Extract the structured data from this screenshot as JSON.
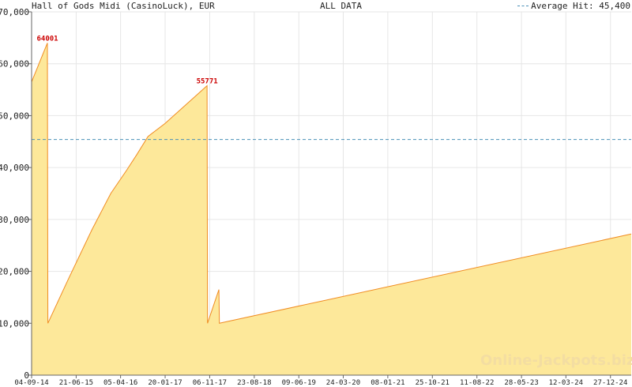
{
  "header": {
    "title": "Hall of Gods Midi (CasinoLuck), EUR",
    "subtitle": "ALL DATA",
    "legend_label": "Average Hit: 45,400"
  },
  "watermark": "Online-Jackpots.biz",
  "colors": {
    "fill": "#fde89a",
    "line": "#f08c22",
    "average": "#4a90b8",
    "peak_label": "#cc0000",
    "grid": "#e6e6e6"
  },
  "chart_data": {
    "type": "area",
    "title": "Hall of Gods Midi (CasinoLuck), EUR",
    "subtitle": "ALL DATA",
    "xlabel": "",
    "ylabel": "",
    "ylim": [
      0,
      70000
    ],
    "yticks": [
      0,
      10000,
      20000,
      30000,
      40000,
      50000,
      60000,
      70000
    ],
    "ytick_labels": [
      "0",
      "10,000",
      "20,000",
      "30,000",
      "40,000",
      "50,000",
      "60,000",
      "70,000"
    ],
    "xlim": [
      "2014-09-04",
      "2025-05-11"
    ],
    "xticks": [
      "2014-09-04",
      "2015-06-21",
      "2016-04-05",
      "2017-01-20",
      "2017-11-06",
      "2018-08-23",
      "2019-06-09",
      "2020-03-24",
      "2021-01-08",
      "2021-10-25",
      "2022-08-11",
      "2023-05-28",
      "2024-03-12",
      "2024-12-27"
    ],
    "xtick_labels": [
      "04-09-14",
      "21-06-15",
      "05-04-16",
      "20-01-17",
      "06-11-17",
      "23-08-18",
      "09-06-19",
      "24-03-20",
      "08-01-21",
      "25-10-21",
      "11-08-22",
      "28-05-23",
      "12-03-24",
      "27-12-24"
    ],
    "grid": true,
    "legend": "top-right",
    "average_hit": 45400,
    "series": [
      {
        "name": "",
        "points": [
          [
            "2014-09-04",
            56500
          ],
          [
            "2014-12-16",
            64001
          ],
          [
            "2014-12-19",
            10000
          ],
          [
            "2015-05-01",
            18500
          ],
          [
            "2015-10-01",
            28000
          ],
          [
            "2016-02-01",
            35000
          ],
          [
            "2016-05-15",
            39500
          ],
          [
            "2016-07-20",
            42500
          ],
          [
            "2016-10-01",
            46000
          ],
          [
            "2017-01-20",
            48500
          ],
          [
            "2017-10-20",
            55771
          ],
          [
            "2017-10-23",
            10000
          ],
          [
            "2018-01-05",
            16500
          ],
          [
            "2018-01-08",
            10000
          ],
          [
            "2025-05-11",
            27200
          ]
        ]
      }
    ],
    "annotations": [
      {
        "x": "2014-12-16",
        "y": 64001,
        "text": "64001"
      },
      {
        "x": "2017-10-20",
        "y": 55771,
        "text": "55771"
      }
    ]
  }
}
